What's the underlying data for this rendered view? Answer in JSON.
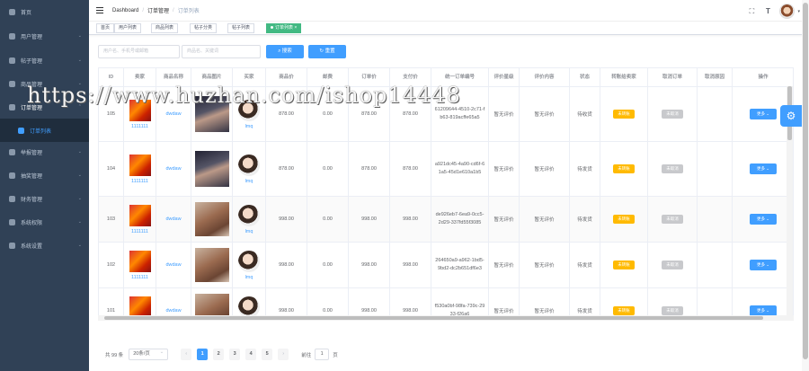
{
  "sidebar": {
    "items": [
      {
        "label": "首页",
        "arrow": ""
      },
      {
        "label": "用户管理",
        "arrow": "⌄"
      },
      {
        "label": "帖子管理",
        "arrow": "⌄"
      },
      {
        "label": "商品管理",
        "arrow": "⌄"
      },
      {
        "label": "订单管理",
        "arrow": "⌃"
      },
      {
        "label": "订单列表",
        "arrow": ""
      },
      {
        "label": "举报管理",
        "arrow": "⌄"
      },
      {
        "label": "抽奖管理",
        "arrow": "⌄"
      },
      {
        "label": "财务管理",
        "arrow": "⌄"
      },
      {
        "label": "系统权限",
        "arrow": "⌄"
      },
      {
        "label": "系统设置",
        "arrow": "⌄"
      }
    ]
  },
  "header": {
    "breadcrumb": [
      "Dashboard",
      "订单管理",
      "订单列表"
    ],
    "sep": "/",
    "font_icon": "T"
  },
  "tags": {
    "items": [
      "首页",
      "用户列表",
      "商品列表",
      "帖子分类",
      "帖子列表",
      "订单列表"
    ]
  },
  "search": {
    "user_placeholder": "用户名、手机号或邮箱",
    "goods_placeholder": "商品名、关键词",
    "search_label": "搜索",
    "reset_label": "重置"
  },
  "table": {
    "columns": [
      "ID",
      "卖家",
      "商品名称",
      "商品图片",
      "买家",
      "商品价",
      "邮费",
      "订单价",
      "支付价",
      "统一订单编号",
      "评价星级",
      "评价内容",
      "状态",
      "转账给卖家",
      "取消订单",
      "取消原因",
      "操作"
    ],
    "rows": [
      {
        "id": "105",
        "seller": "1111111",
        "name": "dwdaw",
        "buyer": "lmq",
        "price": "878.00",
        "postage": "0.00",
        "order_price": "878.00",
        "pay_price": "878.00",
        "order_no": "61209644-4510-2c71-fb63-819acffe65a5",
        "rating": "暂无评价",
        "review": "暂无评价",
        "status": "待收货",
        "transfer": "未转账",
        "cancel": "未取消",
        "reason": "",
        "more": "更多"
      },
      {
        "id": "104",
        "seller": "1111111",
        "name": "dwdaw",
        "buyer": "lmq",
        "price": "878.00",
        "postage": "0.00",
        "order_price": "878.00",
        "pay_price": "878.00",
        "order_no": "a921dc45-4a90-cd6f-61a5-45d1e610a1b5",
        "rating": "暂无评价",
        "review": "暂无评价",
        "status": "待发货",
        "transfer": "未转账",
        "cancel": "未取消",
        "reason": "",
        "more": "更多"
      },
      {
        "id": "103",
        "seller": "1111111",
        "name": "dwdaw",
        "buyer": "lmq",
        "price": "998.00",
        "postage": "0.00",
        "order_price": "998.00",
        "pay_price": "998.00",
        "order_no": "de926eb7-6ea9-0cc5-2d29-337fd55f3085",
        "rating": "暂无评价",
        "review": "暂无评价",
        "status": "待发货",
        "transfer": "未转账",
        "cancel": "未取消",
        "reason": "",
        "more": "更多"
      },
      {
        "id": "102",
        "seller": "1111111",
        "name": "dwdaw",
        "buyer": "lmq",
        "price": "998.00",
        "postage": "0.00",
        "order_price": "998.00",
        "pay_price": "998.00",
        "order_no": "264650a9-a962-1bd5-9bd2-dc2b651df6e3",
        "rating": "暂无评价",
        "review": "暂无评价",
        "status": "待发货",
        "transfer": "未转账",
        "cancel": "未取消",
        "reason": "",
        "more": "更多"
      },
      {
        "id": "101",
        "seller": "1111111",
        "name": "dwdaw",
        "buyer": "lmq",
        "price": "998.00",
        "postage": "0.00",
        "order_price": "998.00",
        "pay_price": "998.00",
        "order_no": "f530a0bf-98fa-739c-2933-f26a6",
        "rating": "暂无评价",
        "review": "暂无评价",
        "status": "待发货",
        "transfer": "未转账",
        "cancel": "未取消",
        "reason": "",
        "more": "更多"
      }
    ]
  },
  "pagination": {
    "total": "共 99 条",
    "page_size": "20条/页",
    "prev": "‹",
    "next": "›",
    "pages": [
      "1",
      "2",
      "3",
      "4",
      "5"
    ],
    "goto_prefix": "前往",
    "goto_value": "1",
    "goto_suffix": "页"
  },
  "watermark": "https://www.huzhan.com/ishop14448",
  "colors": {
    "sidebar_bg": "#304156",
    "primary": "#409eff",
    "tag_active": "#42b983",
    "warning": "#ffba00"
  }
}
